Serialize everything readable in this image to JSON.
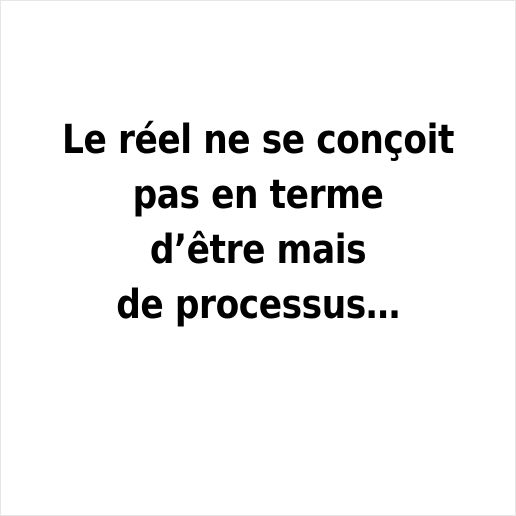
{
  "quote": {
    "lines": [
      "Le réel ne se conçoit",
      "pas en terme",
      "d’être mais",
      "de processus…"
    ]
  },
  "colors": {
    "background": "#ffffff",
    "text": "#000000",
    "border": "#e6e6e6"
  }
}
